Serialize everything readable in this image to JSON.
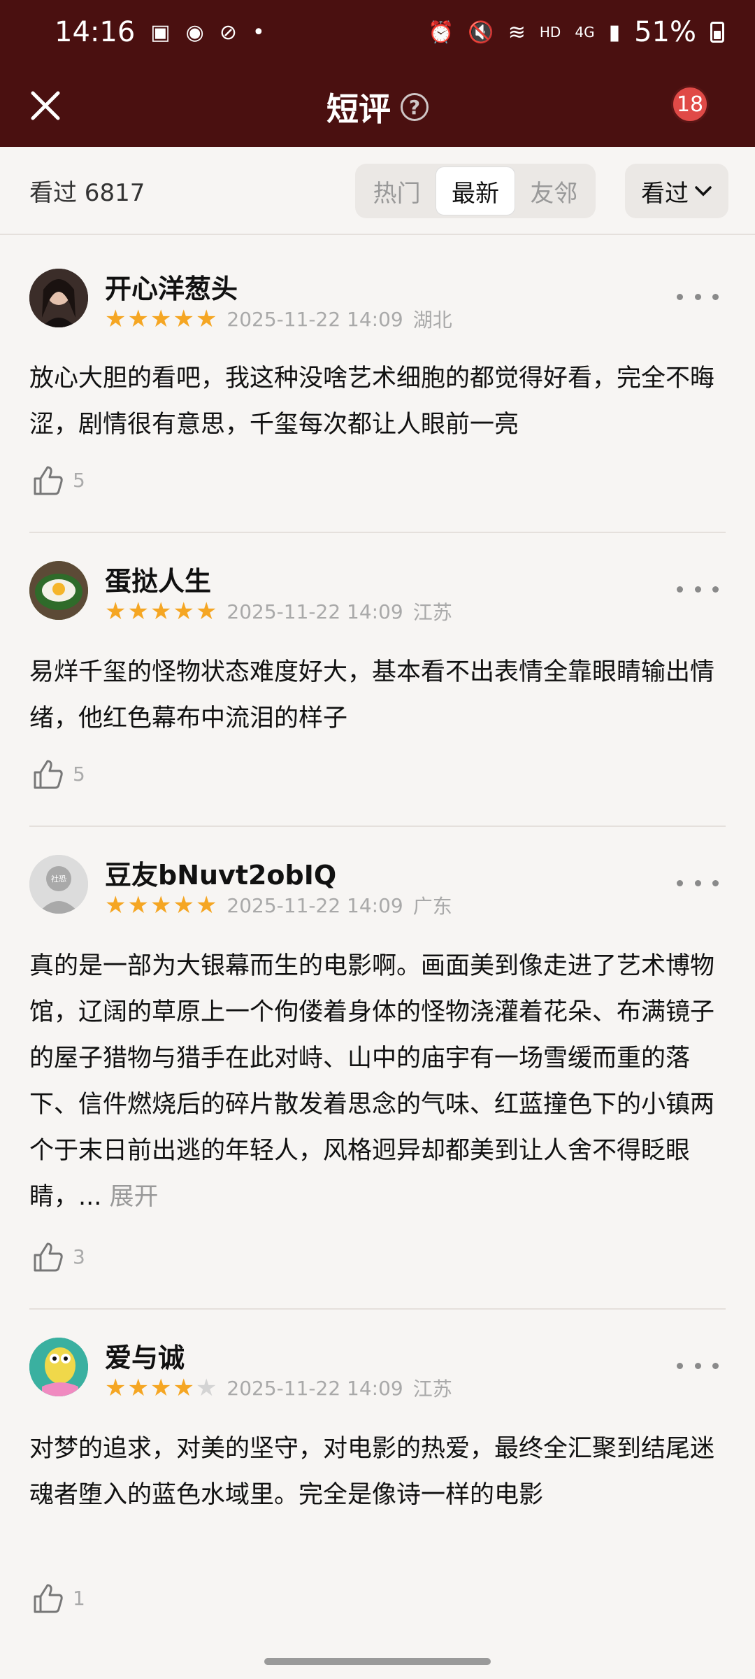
{
  "statusbar": {
    "time": "14:16",
    "battery": "51%",
    "network": "HD",
    "cell": "4G"
  },
  "nav": {
    "title": "短评",
    "badge": "18"
  },
  "filter": {
    "seen_label": "看过 6817",
    "tabs": [
      {
        "label": "热门"
      },
      {
        "label": "最新"
      },
      {
        "label": "友邻"
      }
    ],
    "active_tab": "最新",
    "dropdown_label": "看过"
  },
  "reviews": [
    {
      "user": "开心洋葱头",
      "rating": 5,
      "date": "2025-11-22 14:09",
      "location": "湖北",
      "text": "放心大胆的看吧，我这种没啥艺术细胞的都觉得好看，完全不晦涩，剧情很有意思，千玺每次都让人眼前一亮",
      "likes": "5"
    },
    {
      "user": "蛋挞人生",
      "rating": 5,
      "date": "2025-11-22 14:09",
      "location": "江苏",
      "text": "易烊千玺的怪物状态难度好大，基本看不出表情全靠眼睛输出情绪，他红色幕布中流泪的样子",
      "likes": "5"
    },
    {
      "user": "豆友bNuvt2obIQ",
      "rating": 5,
      "date": "2025-11-22 14:09",
      "location": "广东",
      "text": "真的是一部为大银幕而生的电影啊。画面美到像走进了艺术博物馆，辽阔的草原上一个佝偻着身体的怪物浇灌着花朵、布满镜子的屋子猎物与猎手在此对峙、山中的庙宇有一场雪缓而重的落下、信件燃烧后的碎片散发着思念的气味、红蓝撞色下的小镇两个于末日前出逃的年轻人，风格迥异却都美到让人舍不得眨眼睛，...",
      "expand": "展开",
      "avatar_text": "社恐",
      "likes": "3"
    },
    {
      "user": "爱与诚",
      "rating": 4,
      "date": "2025-11-22 14:09",
      "location": "江苏",
      "text": "对梦的追求，对美的坚守，对电影的热爱，最终全汇聚到结尾迷魂者堕入的蓝色水域里。完全是像诗一样的电影",
      "likes": "1"
    }
  ]
}
